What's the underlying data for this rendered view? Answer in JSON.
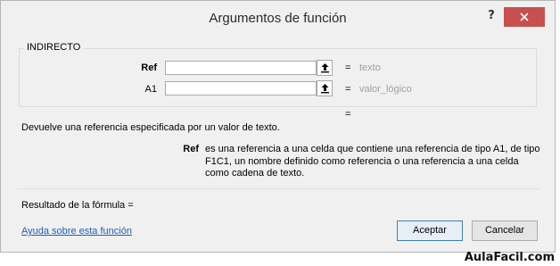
{
  "dialog": {
    "title": "Argumentos de función",
    "help_glyph": "?",
    "close_glyph": "close-icon"
  },
  "function": {
    "name": "INDIRECTO",
    "args": [
      {
        "label": "Ref",
        "value": "",
        "eq": "=",
        "hint": "texto"
      },
      {
        "label": "A1",
        "value": "",
        "eq": "=",
        "hint": "valor_lógico"
      }
    ],
    "result_eq": "="
  },
  "description": "Devuelve una referencia especificada por un valor de texto.",
  "param_help": {
    "name": "Ref",
    "text": "es una referencia a una celda que contiene una referencia de tipo A1, de tipo F1C1, un nombre definido como referencia o una referencia a una celda como cadena de texto."
  },
  "result_label": "Resultado de la fórmula =",
  "help_link": "Ayuda sobre esta función",
  "buttons": {
    "ok": "Aceptar",
    "cancel": "Cancelar"
  },
  "watermark": "AulaFacil.com",
  "colors": {
    "close_bg": "#c74f4f",
    "link": "#1f5fb8",
    "hint": "#a0a0a0"
  }
}
